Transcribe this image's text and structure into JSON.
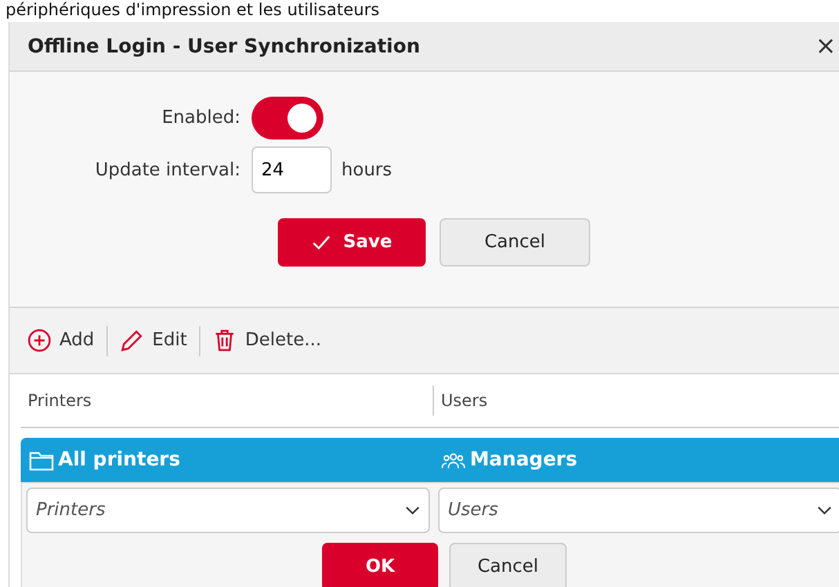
{
  "background_text": "périphériques d'impression et les utilisateurs",
  "dialog": {
    "title": "Offline Login - User Synchronization",
    "close": "×"
  },
  "form": {
    "enabled_label": "Enabled:",
    "enabled": true,
    "interval_label": "Update interval:",
    "interval_value": "24",
    "interval_unit": "hours"
  },
  "form_buttons": [
    {
      "label": "Save",
      "kind": "primary"
    },
    {
      "label": "Cancel",
      "kind": "secondary"
    }
  ],
  "toolbar": [
    {
      "label": "Add",
      "kind": "add"
    },
    {
      "label": "Edit",
      "kind": "edit"
    },
    {
      "label": "Delete...",
      "kind": "delete"
    }
  ],
  "table": {
    "columns": [
      "Printers",
      "Users"
    ],
    "rows": [
      {
        "printers": "All printers",
        "users": "Managers",
        "selected": true
      }
    ]
  },
  "editor": {
    "fields": [
      {
        "placeholder": "Printers"
      },
      {
        "placeholder": "Users"
      }
    ],
    "buttons": [
      {
        "label": "OK",
        "kind": "primary"
      },
      {
        "label": "Cancel",
        "kind": "secondary"
      }
    ]
  }
}
